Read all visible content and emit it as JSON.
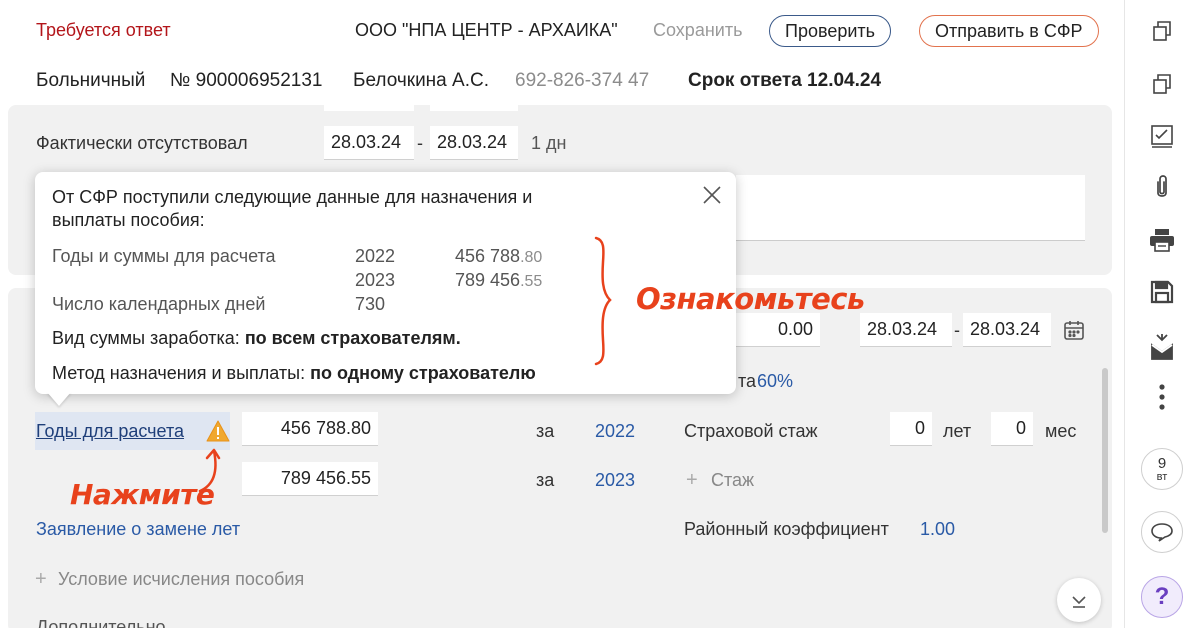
{
  "header": {
    "status": "Требуется ответ",
    "org": "ООО \"НПА ЦЕНТР - АРХАИКА\"",
    "save_label": "Сохранить",
    "check_label": "Проверить",
    "send_label": "Отправить в СФР"
  },
  "subheader": {
    "doc_type": "Больничный",
    "doc_number": "№ 900006952131",
    "person": "Белочкина А.С.",
    "snils": "692-826-374 47",
    "deadline": "Срок ответа 12.04.24"
  },
  "absence": {
    "label": "Фактически отсутствовал",
    "from": "28.03.24",
    "dash": "-",
    "to": "28.03.24",
    "days": "1 дн"
  },
  "popup": {
    "title_line1": "От СФР поступили следующие данные для назначения и",
    "title_line2": "выплаты пособия:",
    "years_label": "Годы и суммы для расчета",
    "rows": [
      {
        "year": "2022",
        "amount_int": "456 788",
        "amount_cents": ".80"
      },
      {
        "year": "2023",
        "amount_int": "789 456",
        "amount_cents": ".55"
      }
    ],
    "days_label": "Число календарных дней",
    "days_value": "730",
    "earnings_label": "Вид суммы заработка:",
    "earnings_value": "по всем страхователям.",
    "method_label": "Метод назначения и выплаты:",
    "method_value": "по одному страхователю"
  },
  "annotations": {
    "review": "Ознакомьтесь",
    "click": "Нажмите"
  },
  "panel2": {
    "amount_field": "0.00",
    "period_from": "28.03.24",
    "period_dash": "-",
    "period_to": "28.03.24",
    "percent_prefix": "та",
    "percent_value": "60%",
    "years_link": "Годы для расчета",
    "year_rows": [
      {
        "amount": "456 788.80",
        "za": "за",
        "year": "2022"
      },
      {
        "amount": "789 456.55",
        "za": "за",
        "year": "2023"
      }
    ],
    "insurance_label": "Страховой стаж",
    "years_value": "0",
    "years_unit": "лет",
    "months_value": "0",
    "months_unit": "мес",
    "add_experience": "Стаж",
    "replace_years_link": "Заявление о замене лет",
    "regional_label": "Районный коэффициент",
    "regional_value": "1.00",
    "condition_label": "Условие исчисления пособия",
    "additional_label": "Дополнительно"
  },
  "sidebar": {
    "date_day": "9",
    "date_weekday": "вт",
    "help": "?"
  },
  "colors": {
    "status_red": "#b3151a",
    "link_blue": "#2a5aa6",
    "annotation_orange": "#e8421c",
    "warning_orange": "#f0a830",
    "help_purple": "#6a3fc0"
  }
}
